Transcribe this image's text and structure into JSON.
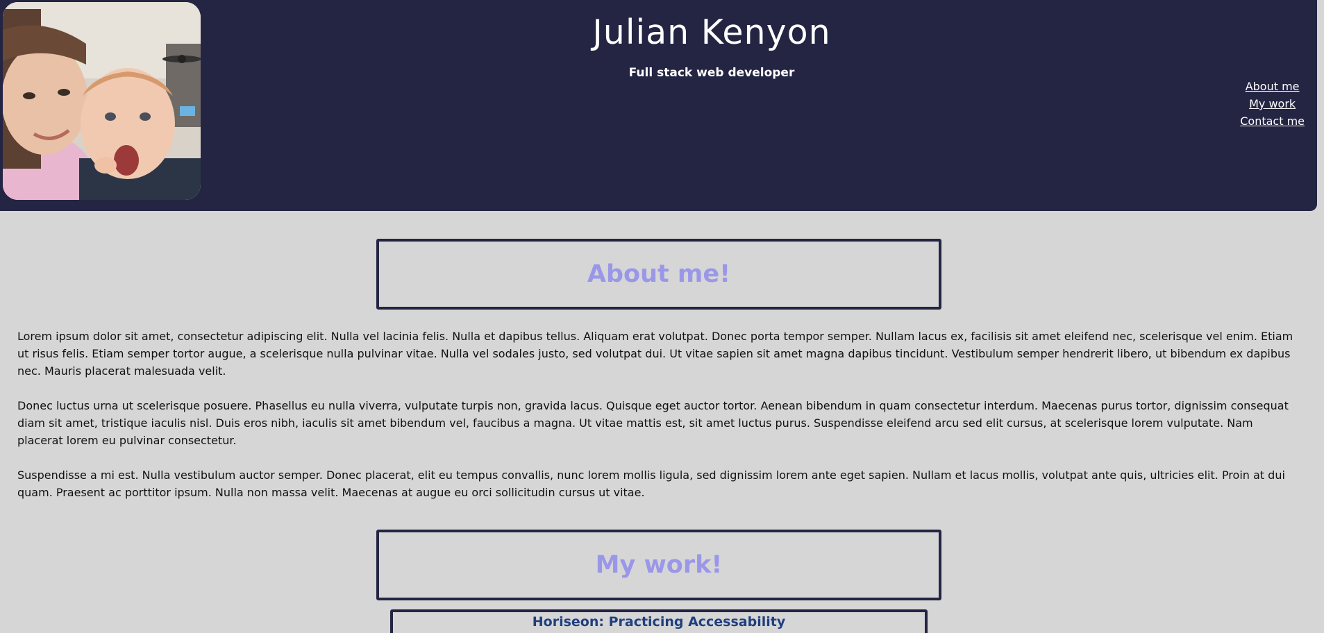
{
  "header": {
    "name": "Julian Kenyon",
    "tagline": "Full stack web developer",
    "avatar_icon": "profile-photo",
    "background_color": "#242443"
  },
  "nav": {
    "items": [
      {
        "label": "About me"
      },
      {
        "label": "My work"
      },
      {
        "label": "Contact me"
      }
    ]
  },
  "about": {
    "heading": "About me!",
    "paragraphs": [
      "Lorem ipsum dolor sit amet, consectetur adipiscing elit. Nulla vel lacinia felis. Nulla et dapibus tellus. Aliquam erat volutpat. Donec porta tempor semper. Nullam lacus ex, facilisis sit amet eleifend nec, scelerisque vel enim. Etiam ut risus felis. Etiam semper tortor augue, a scelerisque nulla pulvinar vitae. Nulla vel sodales justo, sed volutpat dui. Ut vitae sapien sit amet magna dapibus tincidunt. Vestibulum semper hendrerit libero, ut bibendum ex dapibus nec. Mauris placerat malesuada velit.",
      "Donec luctus urna ut scelerisque posuere. Phasellus eu nulla viverra, vulputate turpis non, gravida lacus. Quisque eget auctor tortor. Aenean bibendum in quam consectetur interdum. Maecenas purus tortor, dignissim consequat diam sit amet, tristique iaculis nisl. Duis eros nibh, iaculis sit amet bibendum vel, faucibus a magna. Ut vitae mattis est, sit amet luctus purus. Suspendisse eleifend arcu sed elit cursus, at scelerisque lorem vulputate. Nam placerat lorem eu pulvinar consectetur.",
      "Suspendisse a mi est. Nulla vestibulum auctor semper. Donec placerat, elit eu tempus convallis, nunc lorem mollis ligula, sed dignissim lorem ante eget sapien. Nullam et lacus mollis, volutpat ante quis, ultricies elit. Proin at dui quam. Praesent ac porttitor ipsum. Nulla non massa velit. Maecenas at augue eu orci sollicitudin cursus ut vitae."
    ]
  },
  "work": {
    "heading": "My work!",
    "projects": [
      {
        "title": "Horiseon: Practicing Accessability"
      }
    ]
  },
  "colors": {
    "page_background": "#d6d6d6",
    "heading_text": "#9b97e8",
    "project_title": "#1f3f7e"
  }
}
